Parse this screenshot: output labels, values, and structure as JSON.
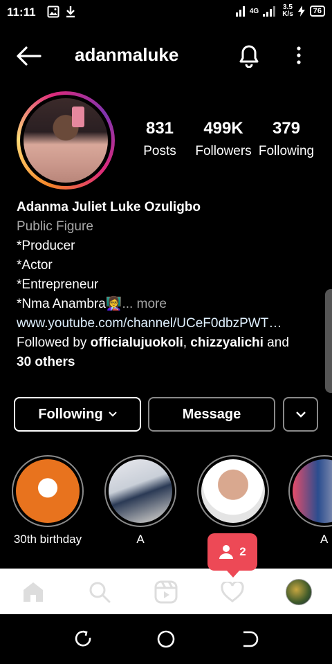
{
  "status_bar": {
    "time": "11:11",
    "network": "4G",
    "speed_value": "3.5",
    "speed_unit": "K/s",
    "battery": "76"
  },
  "header": {
    "username": "adanmaluke"
  },
  "stats": [
    {
      "value": "831",
      "label": "Posts"
    },
    {
      "value": "499K",
      "label": "Followers"
    },
    {
      "value": "379",
      "label": "Following"
    }
  ],
  "bio": {
    "name": "Adanma Juliet Luke Ozuligbo",
    "category": "Public Figure",
    "lines": [
      "*Producer",
      "*Actor",
      "*Entrepreneur"
    ],
    "last_line": "*Nma Anambra👩‍🏫",
    "more": "... more",
    "link": "www.youtube.com/channel/UCeF0dbzPWT…",
    "followed_by_prefix": "Followed by ",
    "followed_user1": "officialujuokoli",
    "followed_sep": ", ",
    "followed_user2": "chizzyalichi",
    "followed_and": " and",
    "followed_others": "30 others"
  },
  "buttons": {
    "following": "Following",
    "message": "Message"
  },
  "highlights": [
    {
      "label": "30th birthday"
    },
    {
      "label": "A"
    },
    {
      "label": ""
    },
    {
      "label": "A"
    }
  ],
  "notification": {
    "count": "2"
  },
  "colors": {
    "accent": "#ed4956",
    "secondary_text": "#a8a8a8"
  }
}
